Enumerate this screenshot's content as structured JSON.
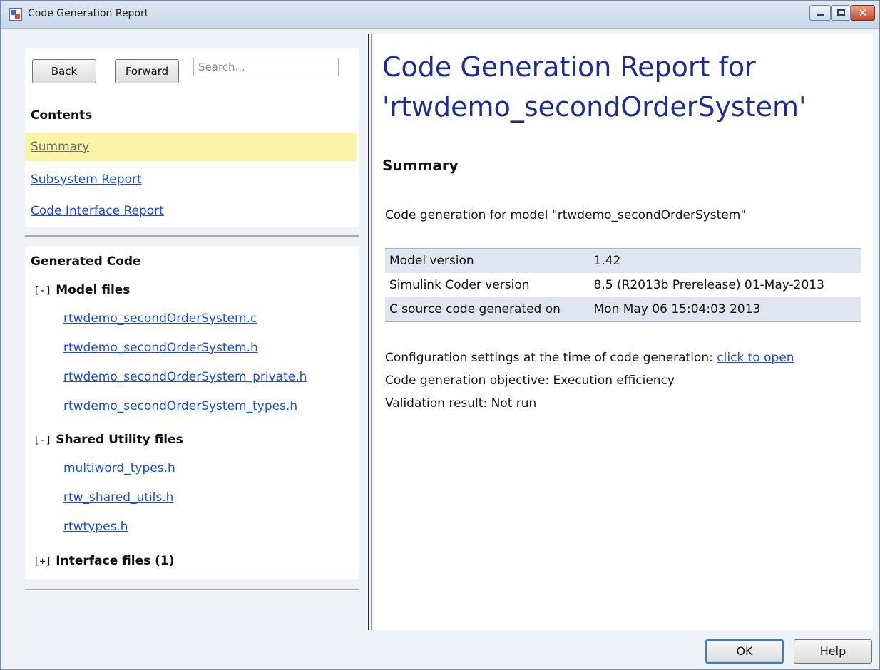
{
  "window": {
    "title": "Code Generation Report"
  },
  "nav": {
    "back_label": "Back",
    "forward_label": "Forward",
    "search_placeholder": "Search...",
    "contents_heading": "Contents",
    "links": [
      {
        "label": "Summary",
        "active": true
      },
      {
        "label": "Subsystem Report",
        "active": false
      },
      {
        "label": "Code Interface Report",
        "active": false
      }
    ]
  },
  "generated_code": {
    "heading": "Generated Code",
    "groups": [
      {
        "toggle": "[-]",
        "label": "Model files",
        "files": [
          "rtwdemo_secondOrderSystem.c",
          "rtwdemo_secondOrderSystem.h",
          "rtwdemo_secondOrderSystem_private.h",
          "rtwdemo_secondOrderSystem_types.h"
        ]
      },
      {
        "toggle": "[-]",
        "label": "Shared Utility files",
        "files": [
          "multiword_types.h",
          "rtw_shared_utils.h",
          "rtwtypes.h"
        ]
      },
      {
        "toggle": "[+]",
        "label": "Interface files (1)",
        "files": []
      }
    ]
  },
  "report": {
    "title_line1": "Code Generation Report for",
    "title_line2": "'rtwdemo_secondOrderSystem'",
    "summary_heading": "Summary",
    "intro": "Code generation for model \"rtwdemo_secondOrderSystem\"",
    "table": [
      {
        "label": "Model version",
        "value": "1.42"
      },
      {
        "label": "Simulink Coder version",
        "value": "8.5 (R2013b Prerelease) 01-May-2013"
      },
      {
        "label": "C source code generated on",
        "value": "Mon May 06 15:04:03 2013"
      }
    ],
    "config_text": "Configuration settings at the time of code generation: ",
    "config_link": "click to open",
    "objective": "Code generation objective: Execution efficiency",
    "validation": "Validation result: Not run"
  },
  "footer": {
    "ok_label": "OK",
    "help_label": "Help"
  },
  "colors": {
    "title_blue": "#1d2d8f",
    "link_blue": "#1a4bd9",
    "active_highlight": "#fbf3a5",
    "table_shade": "#dfe6f2"
  }
}
